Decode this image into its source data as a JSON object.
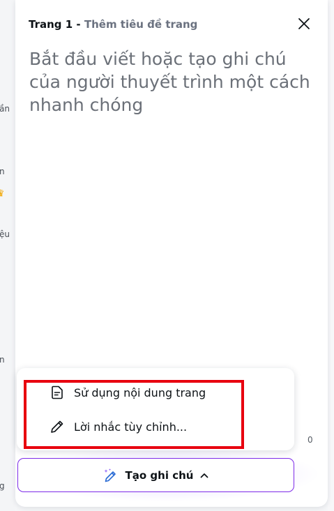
{
  "background": {
    "sidebar_fragments": [
      "ần",
      "n",
      "ệu",
      "n",
      "g"
    ],
    "right_fragment": "0"
  },
  "header": {
    "page_number": "Trang 1",
    "separator": " - ",
    "page_title": "Thêm tiêu đề trang"
  },
  "notes": {
    "placeholder": "Bắt đầu viết hoặc tạo ghi chú của người thuyết trình một cách nhanh chóng"
  },
  "menu": {
    "items": [
      {
        "label": "Sử dụng nội dung trang",
        "icon": "document-icon"
      },
      {
        "label": "Lời nhắc tùy chỉnh...",
        "icon": "pencil-icon"
      }
    ]
  },
  "generate_button": {
    "label": "Tạo ghi chú",
    "icon": "magic-pen-icon",
    "chevron": "chevron-up-icon"
  },
  "colors": {
    "accent": "#7d2ae8",
    "highlight": "#e8000e",
    "crown": "#f2a600"
  }
}
